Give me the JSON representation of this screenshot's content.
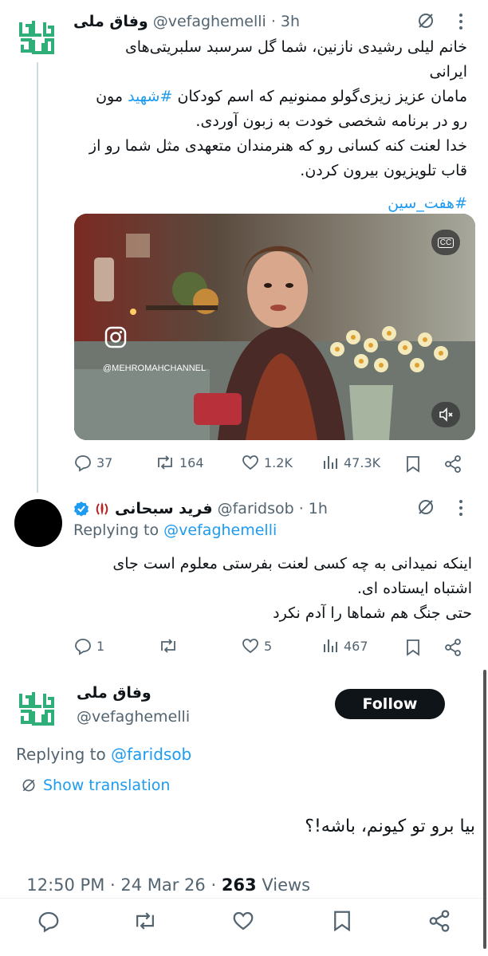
{
  "tweet1": {
    "display_name": "وفاق ملی",
    "handle": "@vefaghemelli",
    "time": "· 3h",
    "lines": [
      "خانم لیلی رشیدی نازنین، شما گل سرسبد سلبریتی‌های",
      "ایرانی",
      "مامان عزیز زیزی‌گولو ممنونیم که اسم کودکان",
      "رو در برنامه شخصی خودت به زبون آوردی.",
      "خدا لعنت کنه کسانی رو که هنرمندان متعهدی مثل شما رو از",
      "قاب تلویزیون بیرون کردن."
    ],
    "line3_hashtag": "#شهید",
    "line3_tail": "مون",
    "hashtag2": "#هفت_سین",
    "video": {
      "watermark": "@MEHROMAHCHANNEL",
      "cc_label": "CC"
    },
    "stats": {
      "replies": "37",
      "retweets": "164",
      "likes": "1.2K",
      "views": "47.3K"
    }
  },
  "tweet2": {
    "display_name": "فرید سبحانی",
    "handle": "@faridsob",
    "time": "· 1h",
    "replying_prefix": "Replying to",
    "replying_handle": "@vefaghemelli",
    "lines": [
      "اینکه نمیدانی به چه کسی لعنت بفرستی معلوم است جای",
      "اشتباه ایستاده ای.",
      "حتی جنگ هم شماها را آدم نکرد"
    ],
    "stats": {
      "replies": "1",
      "retweets": "",
      "likes": "5",
      "views": "467"
    }
  },
  "main_tweet": {
    "display_name": "وفاق ملی",
    "handle": "@vefaghemelli",
    "follow_label": "Follow",
    "replying_prefix": "Replying to",
    "replying_handle": "@faridsob",
    "show_translation": "Show translation",
    "text": "بیا برو تو کیونم، باشه!؟",
    "timestamp": "12:50 PM · 24 Mar 26 · ",
    "views_count": "263",
    "views_label": " Views"
  },
  "colors": {
    "accent": "#1d9bf0",
    "muted": "#536471",
    "logo_green": "#2fae7a",
    "verified": "#1d9bf0"
  }
}
